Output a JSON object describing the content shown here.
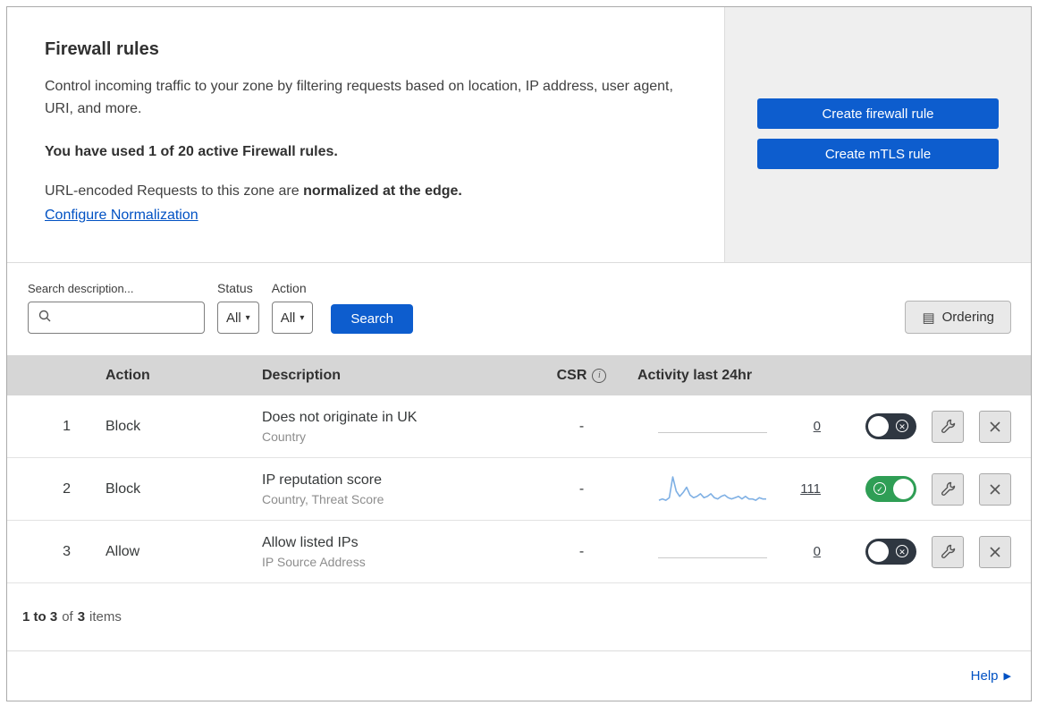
{
  "header": {
    "title": "Firewall rules",
    "description": "Control incoming traffic to your zone by filtering requests based on location, IP address, user agent, URI, and more.",
    "usage": "You have used 1 of 20 active Firewall rules.",
    "normalization_prefix": "URL-encoded Requests to this zone are ",
    "normalization_bold": "normalized at the edge.",
    "normalization_link": "Configure Normalization",
    "create_firewall_button": "Create firewall rule",
    "create_mtls_button": "Create mTLS rule"
  },
  "filters": {
    "search_label": "Search description...",
    "status_label": "Status",
    "status_value": "All",
    "action_label": "Action",
    "action_value": "All",
    "search_button": "Search",
    "ordering_button": "Ordering",
    "ordering_icon": "▤",
    "caret": "▾"
  },
  "table": {
    "columns": {
      "action": "Action",
      "description": "Description",
      "csr": "CSR",
      "csr_info": "i",
      "activity": "Activity last 24hr"
    },
    "rows": [
      {
        "num": "1",
        "action": "Block",
        "title": "Does not originate in UK",
        "subtitle": "Country",
        "csr": "-",
        "count": "0",
        "enabled": false,
        "sparkline": []
      },
      {
        "num": "2",
        "action": "Block",
        "title": "IP reputation score",
        "subtitle": "Country, Threat Score",
        "csr": "-",
        "count": "111",
        "enabled": true,
        "sparkline": [
          2,
          3,
          2,
          4,
          20,
          9,
          5,
          8,
          12,
          6,
          4,
          5,
          7,
          4,
          5,
          7,
          4,
          3,
          5,
          6,
          4,
          3,
          4,
          5,
          3,
          5,
          3,
          3,
          2,
          4,
          3,
          3
        ]
      },
      {
        "num": "3",
        "action": "Allow",
        "title": "Allow listed IPs",
        "subtitle": "IP Source Address",
        "csr": "-",
        "count": "0",
        "enabled": false,
        "sparkline": []
      }
    ]
  },
  "toggle": {
    "on_glyph": "✓",
    "off_glyph": "✕"
  },
  "footer": {
    "range": "1 to 3",
    "of": "of",
    "total": "3",
    "items": "items",
    "help": "Help",
    "help_arrow": "▶"
  },
  "colors": {
    "accent_blue": "#0d5dce",
    "link_blue": "#0051c3",
    "toggle_on_green": "#2f9e55",
    "toggle_off_dark": "#2f3741",
    "header_gray": "#d6d6d6"
  }
}
